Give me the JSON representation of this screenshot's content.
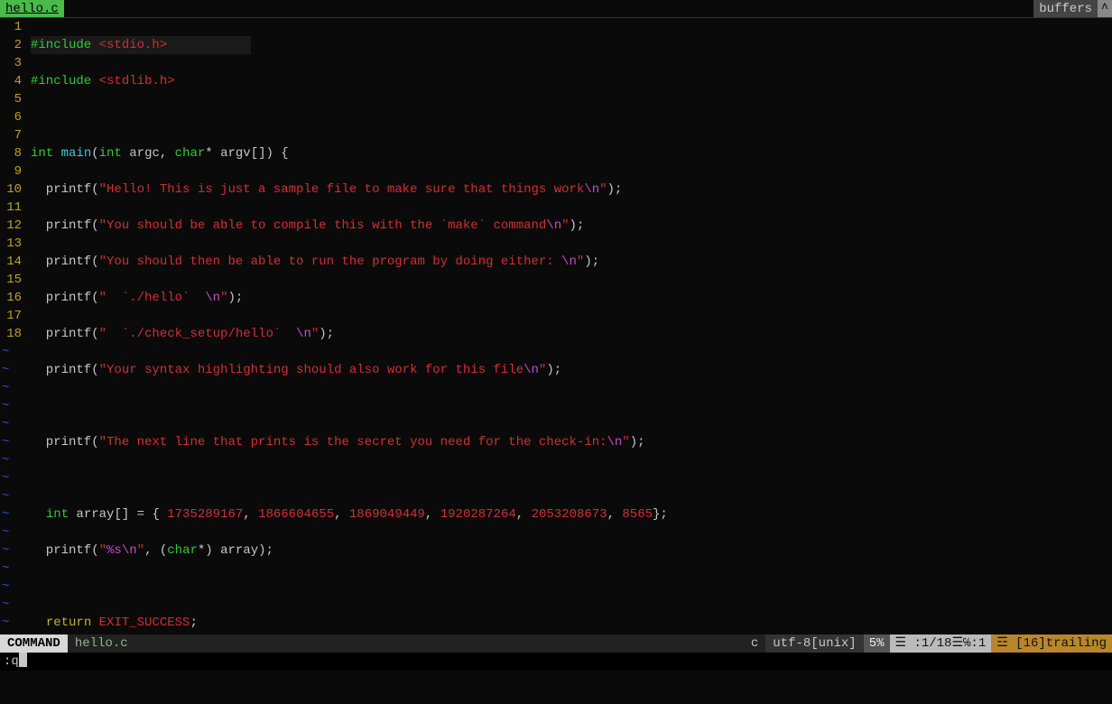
{
  "tabline": {
    "active_tab": "hello.c",
    "buffers_label": "buffers",
    "scroll_indicator": "^"
  },
  "gutter": {
    "lines": [
      "1",
      "2",
      "3",
      "4",
      "5",
      "6",
      "7",
      "8",
      "9",
      "10",
      "11",
      "12",
      "13",
      "14",
      "15",
      "16",
      "17",
      "18"
    ],
    "current": "1"
  },
  "code": {
    "l1_prep": "#include ",
    "l1_inc": "<stdio.h>",
    "l2_prep": "#include ",
    "l2_inc": "<stdlib.h>",
    "l4_a": "int",
    "l4_b": " ",
    "l4_c": "main",
    "l4_d": "(",
    "l4_e": "int",
    "l4_f": " argc, ",
    "l4_g": "char",
    "l4_h": "* argv[]) {",
    "l5_a": "  printf(",
    "l5_b": "\"Hello! This is just a sample file to make sure that things work",
    "l5_c": "\\n",
    "l5_d": "\"",
    "l5_e": ");",
    "l6_a": "  printf(",
    "l6_b": "\"You should be able to compile this with the `make` command",
    "l6_c": "\\n",
    "l6_d": "\"",
    "l6_e": ");",
    "l7_a": "  printf(",
    "l7_b": "\"You should then be able to run the program by doing either: ",
    "l7_c": "\\n",
    "l7_d": "\"",
    "l7_e": ");",
    "l8_a": "  printf(",
    "l8_b": "\"  `./hello`  ",
    "l8_c": "\\n",
    "l8_d": "\"",
    "l8_e": ");",
    "l9_a": "  printf(",
    "l9_b": "\"  `./check_setup/hello`  ",
    "l9_c": "\\n",
    "l9_d": "\"",
    "l9_e": ");",
    "l10_a": "  printf(",
    "l10_b": "\"Your syntax highlighting should also work for this file",
    "l10_c": "\\n",
    "l10_d": "\"",
    "l10_e": ");",
    "l12_a": "  printf(",
    "l12_b": "\"The next line that prints is the secret you need for the check-in:",
    "l12_c": "\\n",
    "l12_d": "\"",
    "l12_e": ");",
    "l14_a": "  ",
    "l14_b": "int",
    "l14_c": " array[] = { ",
    "l14_n1": "1735289167",
    "l14_s1": ", ",
    "l14_n2": "1866604655",
    "l14_s2": ", ",
    "l14_n3": "1869049449",
    "l14_s3": ", ",
    "l14_n4": "1920287264",
    "l14_s4": ", ",
    "l14_n5": "2053208673",
    "l14_s5": ", ",
    "l14_n6": "8565",
    "l14_e": "};",
    "l15_a": "  printf(",
    "l15_b": "\"",
    "l15_c": "%s",
    "l15_d": "\\n",
    "l15_e": "\"",
    "l15_f": ", (",
    "l15_g": "char",
    "l15_h": "*) array);",
    "l17_a": "  ",
    "l17_b": "return",
    "l17_c": " ",
    "l17_d": "EXIT_SUCCESS",
    "l17_e": ";",
    "l18": "}"
  },
  "tilde": "~",
  "statusline": {
    "mode": "COMMAND",
    "file": "hello.c",
    "filetype": "c",
    "encoding": "utf-8[unix]",
    "percent": "5%",
    "position": "☰ :1/18☰℅:1",
    "trailing": "☲ [16]trailing"
  },
  "cmdline": {
    "text": ":q"
  }
}
